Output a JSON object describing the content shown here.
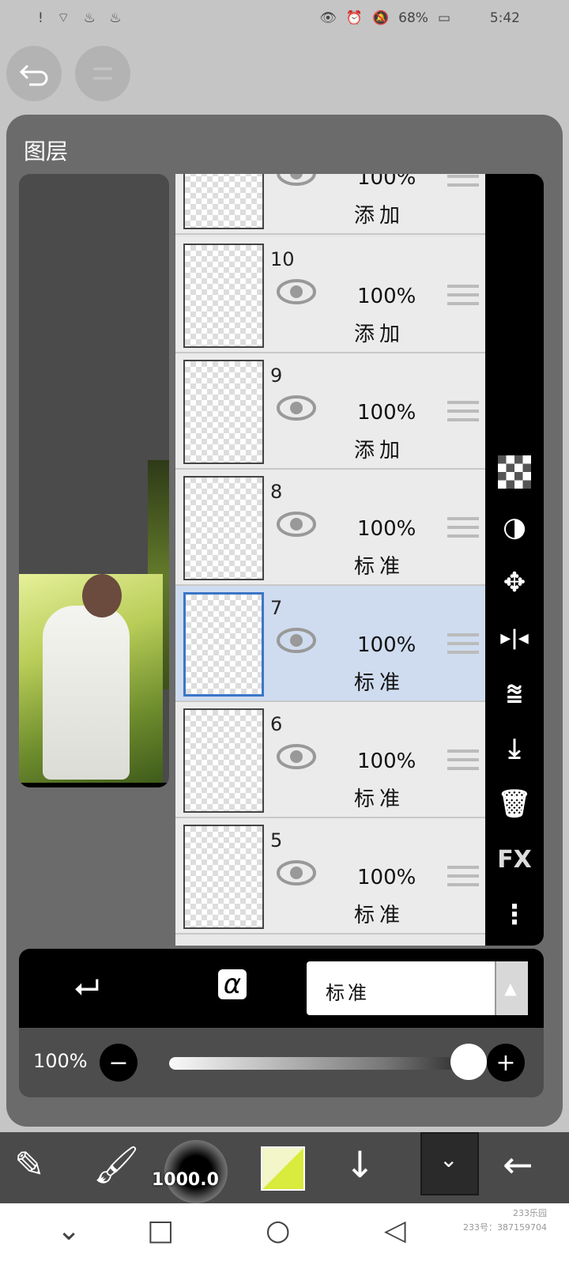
{
  "status_bar": {
    "left_icons": "!  ⌔  ♨ ♨",
    "battery": "68%",
    "time": "5:42"
  },
  "top_buttons": [
    "undo-icon",
    "redo-icon"
  ],
  "panel": {
    "title": "图层"
  },
  "layers": [
    {
      "num": "",
      "opacity": "100%",
      "mode": "添加",
      "selected": false
    },
    {
      "num": "10",
      "opacity": "100%",
      "mode": "添加",
      "selected": false
    },
    {
      "num": "9",
      "opacity": "100%",
      "mode": "添加",
      "selected": false
    },
    {
      "num": "8",
      "opacity": "100%",
      "mode": "标准",
      "selected": false
    },
    {
      "num": "7",
      "opacity": "100%",
      "mode": "标准",
      "selected": true
    },
    {
      "num": "6",
      "opacity": "100%",
      "mode": "标准",
      "selected": false
    },
    {
      "num": "5",
      "opacity": "100%",
      "mode": "标准",
      "selected": false
    }
  ],
  "left_tools": [
    "add-layer-icon",
    "flip-horizontal-icon",
    "duplicate-layer-icon",
    "flip-vertical-icon",
    "camera-icon"
  ],
  "right_tools": [
    "transparency-icon",
    "contrast-icon",
    "move-icon",
    "flip-horizontal-icon",
    "flip-vertical-icon",
    "merge-down-icon",
    "trash-icon",
    "fx-icon",
    "more-icon"
  ],
  "right_tools_fx_label": "FX",
  "bottom": {
    "blend_mode": "标准",
    "alpha_lock_label": "α"
  },
  "opacity": {
    "value_label": "100%",
    "value": 1.0
  },
  "toolbar": {
    "brush_size": "1000.0",
    "color": "#d9eb3c"
  },
  "watermark": {
    "line1": "233乐园",
    "line2": "233号：387159704"
  },
  "colors": {
    "panel": "#6b6b6b",
    "selected": "#cfdcef",
    "accent": "#3a76c7"
  }
}
